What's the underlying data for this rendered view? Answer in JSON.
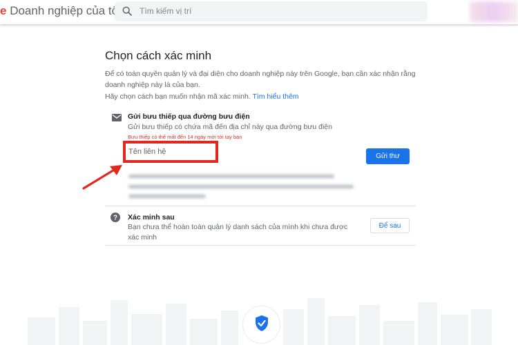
{
  "header": {
    "brand_letter": "e",
    "app_name": "Doanh nghiệp của tôi",
    "search_placeholder": "Tìm kiếm vị trí"
  },
  "main": {
    "title": "Chọn cách xác minh",
    "description": "Để có toàn quyền quản lý và đại diện cho doanh nghiệp này trên Google, bạn cần xác nhận rằng doanh nghiệp này là của bạn.",
    "choose_text": "Hãy chọn cách bạn muốn nhận mã xác minh.",
    "learn_more": "Tìm hiểu thêm"
  },
  "option_postcard": {
    "icon": "mail-icon",
    "title": "Gửi bưu thiếp qua đường bưu điện",
    "description": "Gửi bưu thiếp có chứa mã đến địa chỉ này qua đường bưu điện",
    "warning": "Bưu thiếp có thể mất đến 14 ngày mới tới tay bạn",
    "contact_label": "Tên liên hệ",
    "send_button": "Gửi thư"
  },
  "option_later": {
    "icon": "help-icon",
    "title": "Xác minh sau",
    "description": "Bạn chưa thể hoàn toàn quản lý danh sách của mình khi chưa được xác minh",
    "later_button": "Để sau"
  },
  "colors": {
    "accent": "#1a73e8",
    "highlight": "#e0281e",
    "warning": "#d93025"
  }
}
